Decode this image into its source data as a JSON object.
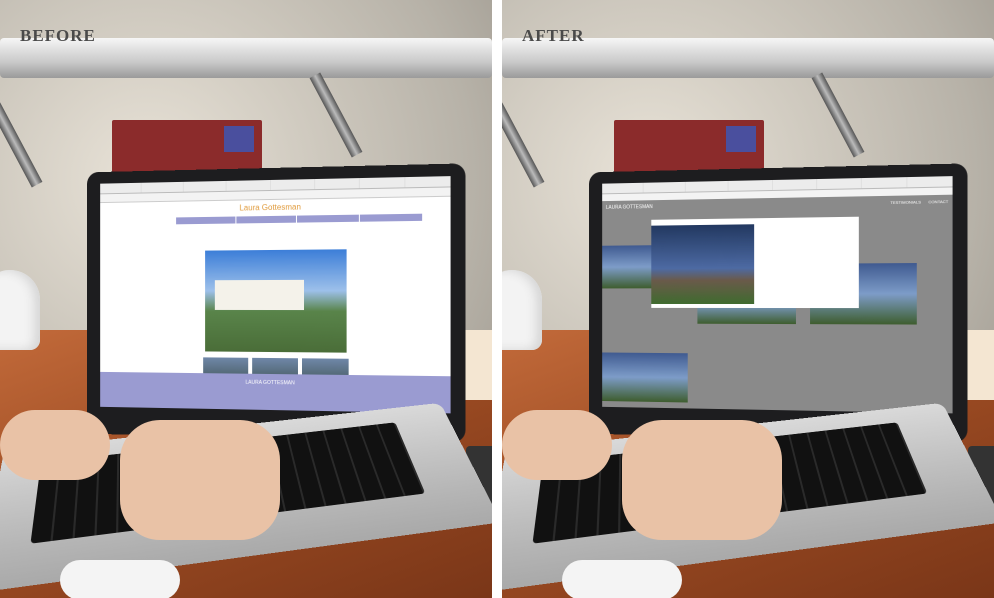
{
  "labels": {
    "before": "BEFORE",
    "after": "AFTER"
  },
  "before_site": {
    "name": "Laura Gottesman",
    "footer_name": "LAURA GOTTESMAN"
  },
  "after_site": {
    "header_name": "LAURA GOTTESMAN",
    "nav_item": "TESTIMONIALS",
    "nav_contact": "CONTACT"
  },
  "colors": {
    "accent_purple": "#9a9bd1",
    "name_orange": "#e09b3d",
    "modal_dim": "#8a8a8a"
  }
}
